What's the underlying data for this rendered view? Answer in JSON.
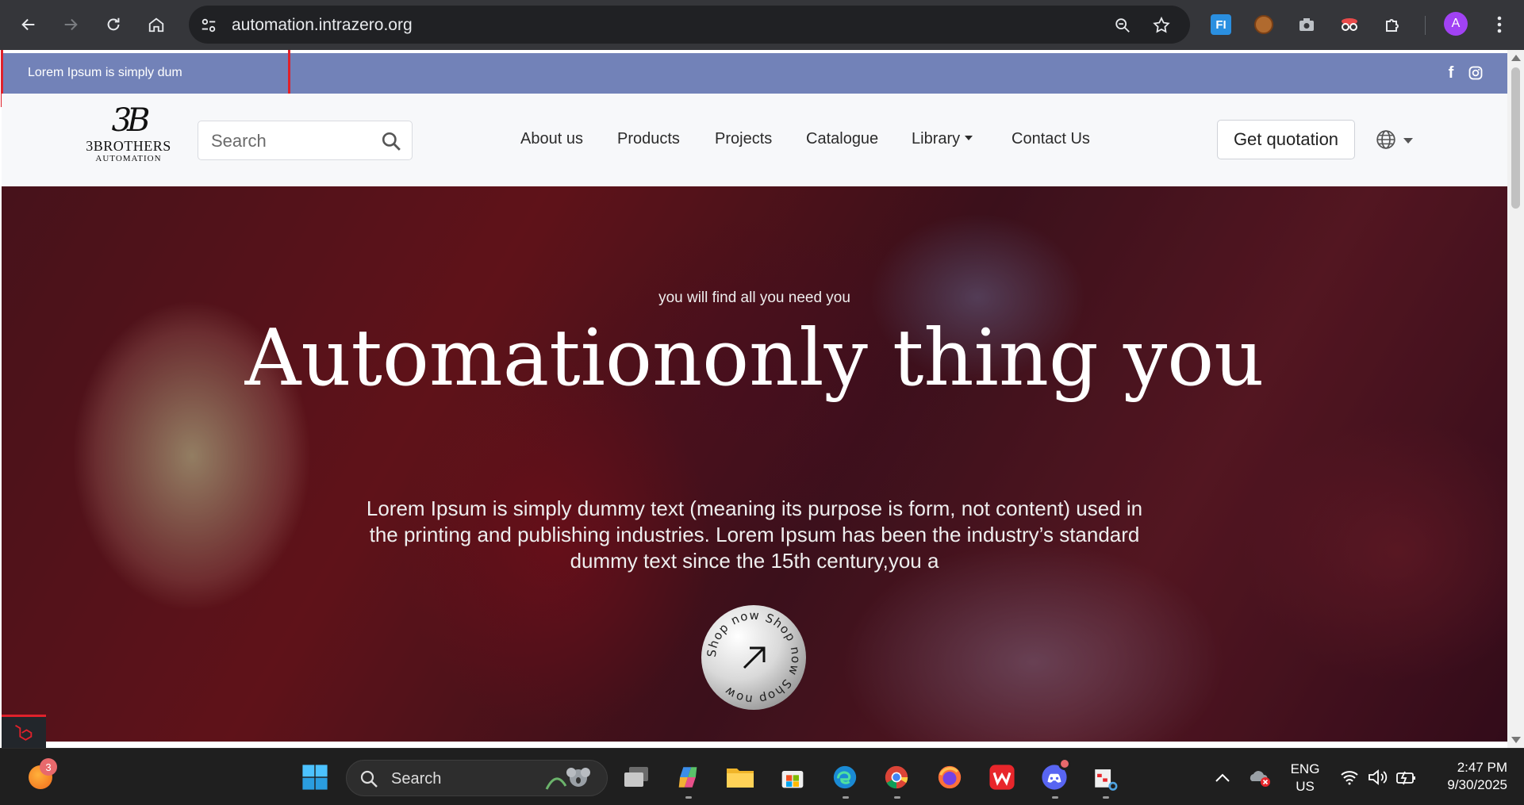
{
  "browser": {
    "url": "automation.intrazero.org",
    "profile_initial": "A",
    "extension_label": "FI"
  },
  "site": {
    "announcement": "Lorem Ipsum is simply dum",
    "logo": {
      "mark": "3B",
      "name": "3BROTHERS",
      "sub": "AUTOMATION"
    },
    "search": {
      "placeholder": "Search"
    },
    "nav": [
      {
        "label": "About us"
      },
      {
        "label": "Products"
      },
      {
        "label": "Projects"
      },
      {
        "label": "Catalogue"
      },
      {
        "label": "Library"
      },
      {
        "label": "Contact Us"
      }
    ],
    "quote_button": "Get quotation",
    "hero": {
      "kicker": "you will find all you need you",
      "title": "Automationonly thing you",
      "description": "Lorem Ipsum is simply dummy text (meaning its purpose is form, not content) used in the printing and publishing industries. Lorem Ipsum has been the industry’s standard dummy text since the 15th century,you a",
      "badge_text": "Shop now Shop now Shop now "
    },
    "social": {
      "facebook": "f"
    }
  },
  "taskbar": {
    "notification_count": "3",
    "search_label": "Search",
    "language": "ENG",
    "region": "US",
    "time": "2:47 PM",
    "date": "9/30/2025"
  },
  "colors": {
    "announcement_bg": "#7282b8",
    "highlight": "#e0212b"
  }
}
